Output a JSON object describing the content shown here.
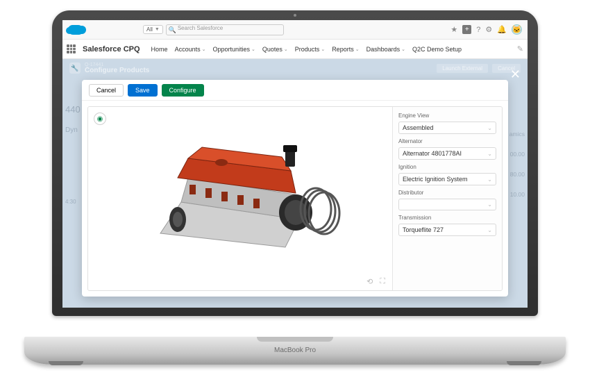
{
  "topbar": {
    "search_scope": "All",
    "search_placeholder": "Search Salesforce"
  },
  "nav": {
    "app_name": "Salesforce CPQ",
    "items": [
      "Home",
      "Accounts",
      "Opportunities",
      "Quotes",
      "Products",
      "Reports",
      "Dashboards"
    ],
    "extra": "Q2C Demo Setup"
  },
  "config_bar": {
    "code": "Q-17441",
    "title": "Configure Products",
    "launch": "Launch External",
    "cancel": "Cancel"
  },
  "modal": {
    "cancel": "Cancel",
    "save": "Save",
    "configure": "Configure"
  },
  "panel": {
    "engine_view_label": "Engine View",
    "engine_view_value": "Assembled",
    "alternator_label": "Alternator",
    "alternator_value": "Alternator 4801778AI",
    "ignition_label": "Ignition",
    "ignition_value": "Electric Ignition System",
    "distributor_label": "Distributor",
    "distributor_value": "",
    "transmission_label": "Transmission",
    "transmission_value": "Torqueflite 727"
  },
  "ghost": {
    "left_title": "440",
    "left_sub": "Dyn",
    "left_row": "4:30",
    "r1": "amics",
    "r2": "00.00",
    "r3": "80.00",
    "r4": "10.00"
  },
  "base_label": "MacBook Pro"
}
